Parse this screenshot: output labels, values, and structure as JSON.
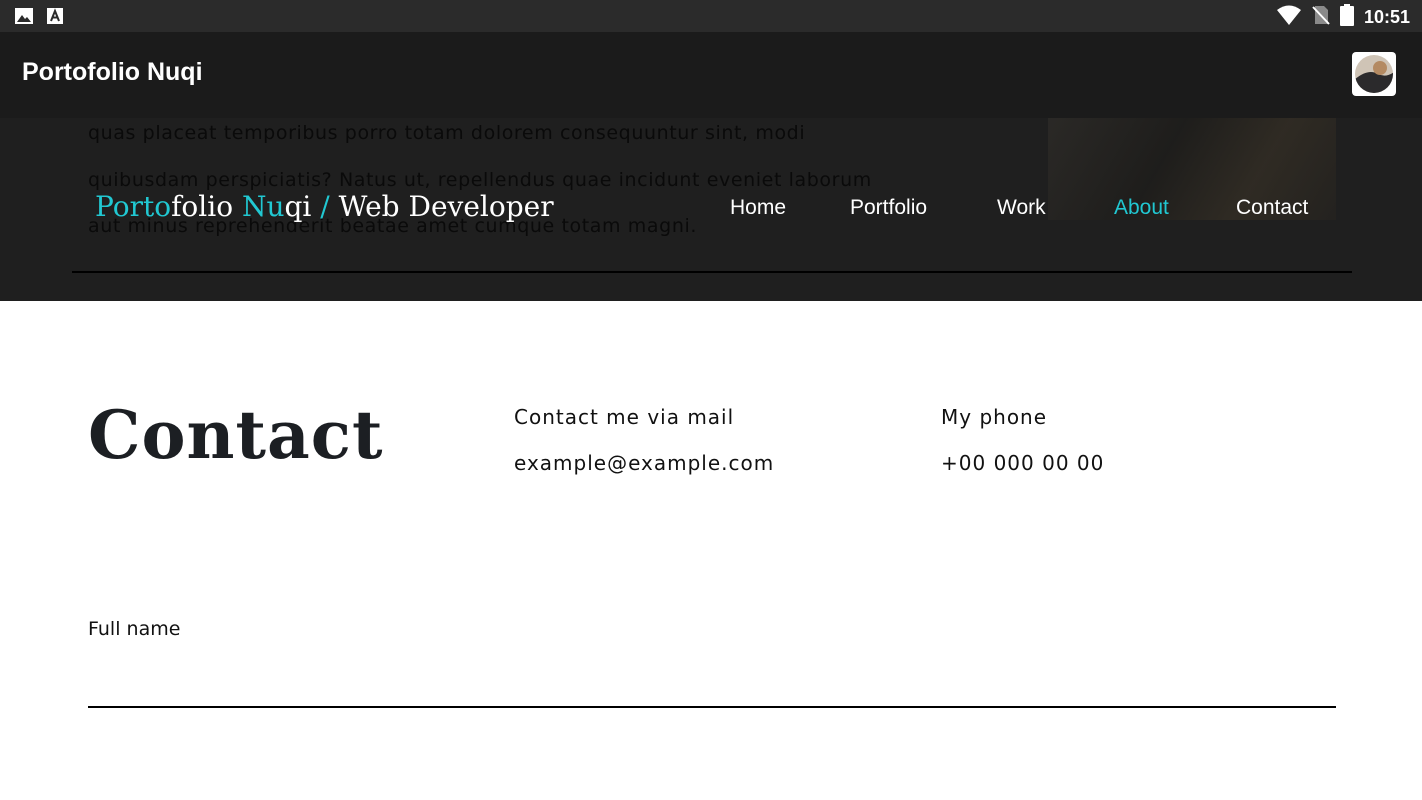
{
  "status_bar": {
    "time": "10:51",
    "icons": [
      "image-icon",
      "font-icon",
      "wifi-icon",
      "no-sim-icon",
      "battery-icon"
    ]
  },
  "app_bar": {
    "title": "Portofolio Nuqi",
    "avatar_icon": "avatar-image"
  },
  "header": {
    "background_text": [
      "quas placeat temporibus porro totam dolorem consequuntur sint, modi",
      "quibusdam perspiciatis? Natus ut, repellendus quae incidunt eveniet laborum",
      "aut minus reprehenderit beatae amet cumque totam magni."
    ],
    "brand": {
      "part1_accent": "Porto",
      "part2": "folio ",
      "part3_accent": "Nu",
      "part4": "qi ",
      "part5_accent": "/",
      "part6": " Web Developer"
    },
    "nav": [
      {
        "label": "Home",
        "active": false
      },
      {
        "label": "Portfolio",
        "active": false
      },
      {
        "label": "Work",
        "active": false
      },
      {
        "label": "About",
        "active": true
      },
      {
        "label": "Contact",
        "active": false
      }
    ]
  },
  "contact": {
    "title": "Contact",
    "mail_label": "Contact me via mail",
    "mail_value": "example@example.com",
    "phone_label": "My phone",
    "phone_value": "+00 000 00 00"
  },
  "form": {
    "full_name_label": "Full name",
    "full_name_value": ""
  },
  "colors": {
    "accent": "#21c8d2",
    "header_bg": "#1f1f1f",
    "app_bar_bg": "#1b1b1b",
    "status_bar_bg": "#2b2b2b"
  }
}
